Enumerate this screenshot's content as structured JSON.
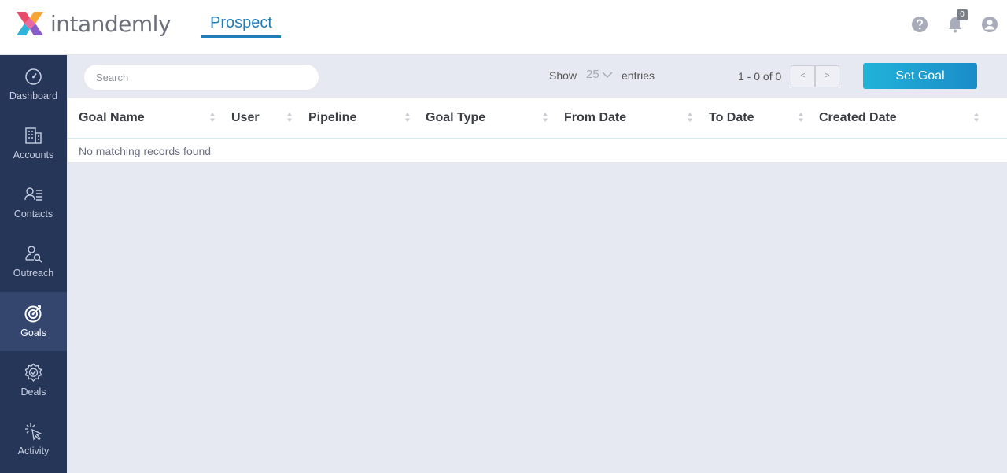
{
  "app": {
    "logo_text": "intandemly",
    "module_title": "Prospect"
  },
  "header": {
    "notification_count": "0",
    "icons": [
      "help-icon",
      "bell-icon",
      "user-icon"
    ]
  },
  "sidebar": {
    "items": [
      {
        "label": "Dashboard",
        "icon": "gauge-icon",
        "active": false
      },
      {
        "label": "Accounts",
        "icon": "building-icon",
        "active": false
      },
      {
        "label": "Contacts",
        "icon": "contacts-icon",
        "active": false
      },
      {
        "label": "Outreach",
        "icon": "outreach-icon",
        "active": false
      },
      {
        "label": "Goals",
        "icon": "target-icon",
        "active": true
      },
      {
        "label": "Deals",
        "icon": "deals-icon",
        "active": false
      },
      {
        "label": "Activity",
        "icon": "activity-icon",
        "active": false
      }
    ]
  },
  "toolbar": {
    "search_placeholder": "Search",
    "show_label": "Show",
    "entries_per_page": "25",
    "entries_label": "entries",
    "pagination_info": "1 - 0 of 0",
    "prev_label": "<",
    "next_label": ">",
    "set_goal_label": "Set Goal"
  },
  "table": {
    "columns": [
      "Goal Name",
      "User",
      "Pipeline",
      "Goal Type",
      "From Date",
      "To Date",
      "Created Date"
    ],
    "empty_message": "No matching records found"
  },
  "colors": {
    "accent": "#1f7db7",
    "sidebar_bg": "#263659",
    "sidebar_active": "#34466d",
    "button_gradient_start": "#21b3d9",
    "button_gradient_end": "#1a8cc8"
  }
}
